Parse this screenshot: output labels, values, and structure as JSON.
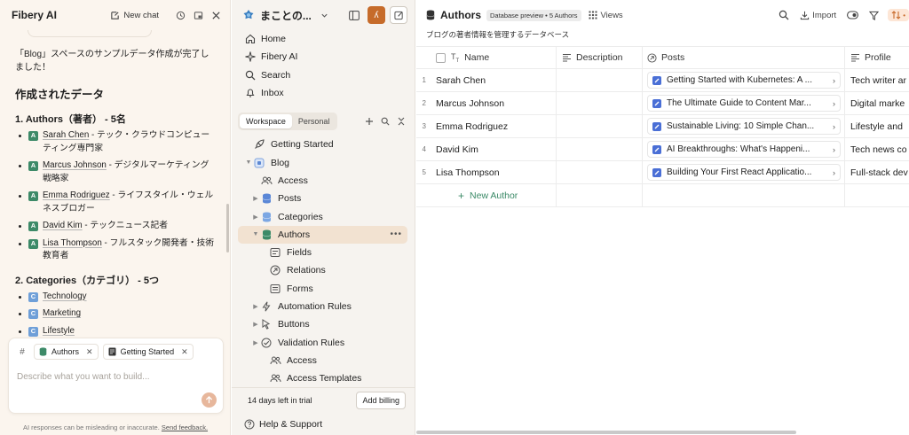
{
  "ai_panel": {
    "title": "Fibery AI",
    "new_chat": "New chat",
    "intro": "「Blog」スペースのサンプルデータ作成が完了しました！",
    "heading": "作成されたデータ",
    "authors_heading": "1. Authors（著者） - 5名",
    "authors": [
      {
        "badge": "A",
        "name": "Sarah Chen",
        "desc": " - テック・クラウドコンピューティング専門家"
      },
      {
        "badge": "A",
        "name": "Marcus Johnson",
        "desc": " - デジタルマーケティング戦略家"
      },
      {
        "badge": "A",
        "name": "Emma Rodriguez",
        "desc": " - ライフスタイル・ウェルネスブロガー"
      },
      {
        "badge": "A",
        "name": "David Kim",
        "desc": " - テックニュース記者"
      },
      {
        "badge": "A",
        "name": "Lisa Thompson",
        "desc": " - フルスタック開発者・技術教育者"
      }
    ],
    "categories_heading": "2. Categories（カテゴリ） - 5つ",
    "categories": [
      {
        "badge": "C",
        "name": "Technology"
      },
      {
        "badge": "C",
        "name": "Marketing"
      },
      {
        "badge": "C",
        "name": "Lifestyle"
      }
    ],
    "context_hash": "#",
    "context_chips": [
      {
        "label": "Authors",
        "icon": "database-icon"
      },
      {
        "label": "Getting Started",
        "icon": "document-icon"
      }
    ],
    "input_placeholder": "Describe what you want to build...",
    "disclaimer": "AI responses can be misleading or inaccurate.",
    "feedback_link": "Send feedback."
  },
  "sidebar": {
    "workspace_name": "まことの...",
    "user_initial": "ʎ",
    "nav": [
      {
        "label": "Home",
        "icon": "home-icon"
      },
      {
        "label": "Fibery AI",
        "icon": "sparkle-icon"
      },
      {
        "label": "Search",
        "icon": "search-icon"
      },
      {
        "label": "Inbox",
        "icon": "bell-icon"
      }
    ],
    "tabs": [
      "Workspace",
      "Personal"
    ],
    "active_tab": "Workspace",
    "tree": {
      "getting_started": "Getting Started",
      "blog": "Blog",
      "access": "Access",
      "posts": "Posts",
      "categories": "Categories",
      "authors": "Authors",
      "fields": "Fields",
      "relations": "Relations",
      "forms": "Forms",
      "automation_rules": "Automation Rules",
      "buttons": "Buttons",
      "validation_rules": "Validation Rules",
      "authors_access": "Access",
      "access_templates": "Access Templates"
    },
    "trial_text": "14 days left in trial",
    "billing_button": "Add billing",
    "help": "Help & Support"
  },
  "main": {
    "title": "Authors",
    "badge": "Database preview • 5 Authors",
    "views_label": "Views",
    "import_label": "Import",
    "subtitle": "ブログの著者情報を管理するデータベース",
    "columns": [
      "Name",
      "Description",
      "Posts",
      "Profile"
    ],
    "rows": [
      {
        "num": "1",
        "name": "Sarah Chen",
        "post": "Getting Started with Kubernetes: A ...",
        "profile": "Tech writer ar"
      },
      {
        "num": "2",
        "name": "Marcus Johnson",
        "post": "The Ultimate Guide to Content Mar...",
        "profile": "Digital marke"
      },
      {
        "num": "3",
        "name": "Emma Rodriguez",
        "post": "Sustainable Living: 10 Simple Chan...",
        "profile": "Lifestyle and"
      },
      {
        "num": "4",
        "name": "David Kim",
        "post": "AI Breakthroughs: What's Happeni...",
        "profile": "Tech news co"
      },
      {
        "num": "5",
        "name": "Lisa Thompson",
        "post": "Building Your First React Applicatio...",
        "profile": "Full-stack dev"
      }
    ],
    "new_row_label": "New Author"
  },
  "colors": {
    "accent": "#c66b2a",
    "author_badge": "#3d8a68",
    "category_badge": "#6f9fd8",
    "post_icon": "#4a6fd6",
    "new_author_green": "#3b8a67"
  }
}
